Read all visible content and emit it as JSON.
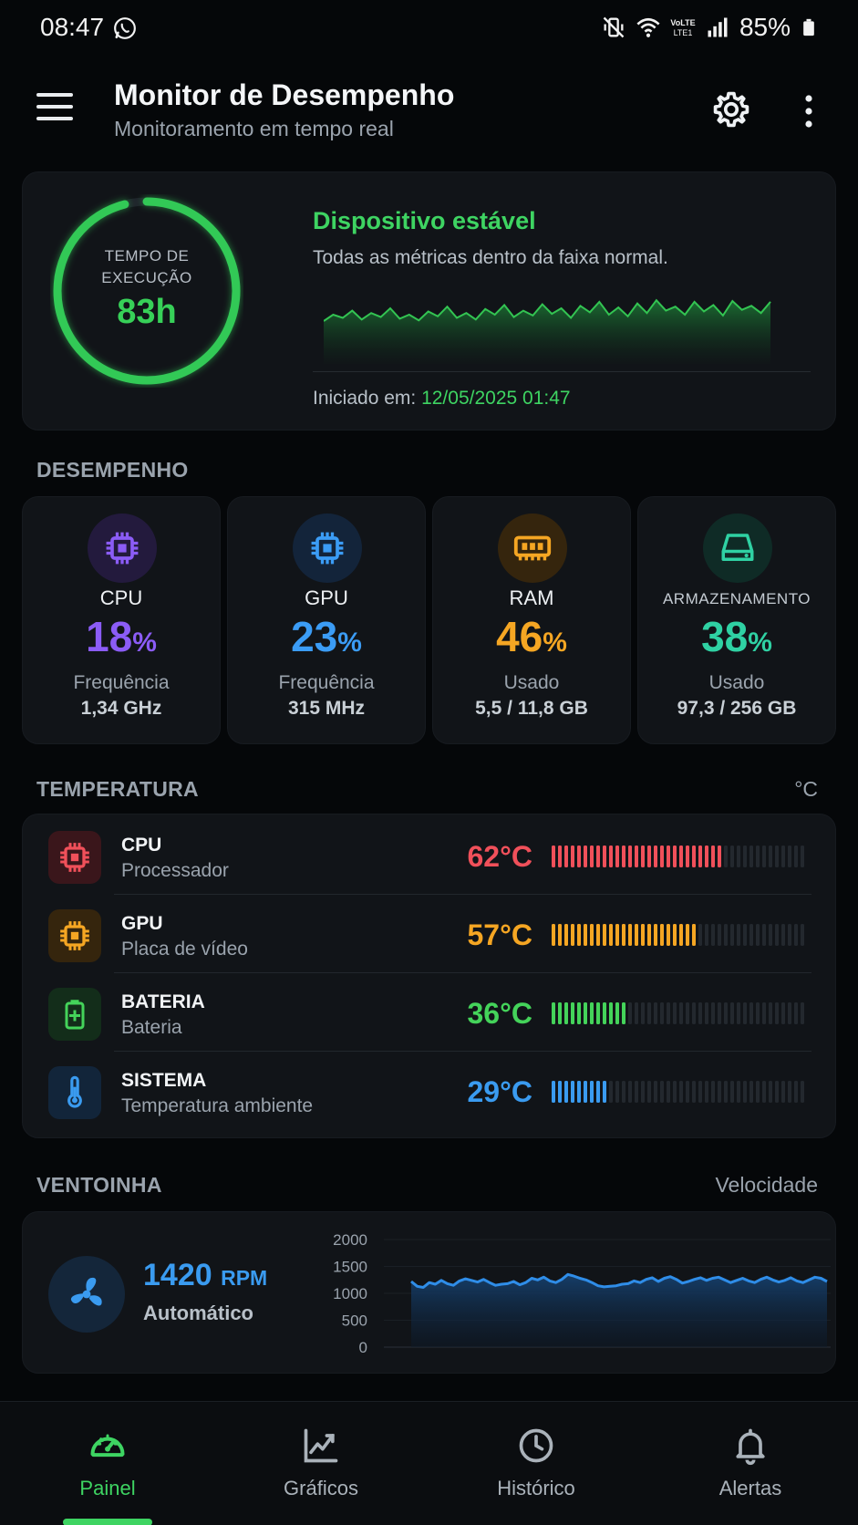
{
  "status_bar": {
    "time": "08:47",
    "battery": "85%",
    "icons": [
      "whatsapp-icon",
      "mute-vibrate-icon",
      "wifi-icon",
      "volte-icon",
      "signal-icon",
      "battery-icon"
    ]
  },
  "app_bar": {
    "title": "Monitor de Desempenho",
    "subtitle": "Monitoramento em tempo real",
    "icons": [
      "menu-icon",
      "gear-icon",
      "more-vert-icon"
    ]
  },
  "hero": {
    "ring_label_line1": "TEMPO DE",
    "ring_label_line2": "EXECUÇÃO",
    "ring_value": "83h",
    "ring_progress": 0.96,
    "status": "Dispositivo estável",
    "description": "Todas as métricas dentro da faixa normal.",
    "started_label": "Iniciado em:",
    "started_value": "12/05/2025 01:47",
    "sparkline": [
      0.42,
      0.5,
      0.46,
      0.55,
      0.44,
      0.52,
      0.47,
      0.58,
      0.45,
      0.5,
      0.43,
      0.54,
      0.48,
      0.6,
      0.46,
      0.52,
      0.44,
      0.57,
      0.5,
      0.62,
      0.47,
      0.55,
      0.49,
      0.63,
      0.51,
      0.58,
      0.46,
      0.61,
      0.53,
      0.66,
      0.5,
      0.59,
      0.48,
      0.64,
      0.52,
      0.68,
      0.55,
      0.6,
      0.5,
      0.66,
      0.54,
      0.62,
      0.49,
      0.67,
      0.56,
      0.61,
      0.52,
      0.66
    ]
  },
  "performance": {
    "title": "DESEMPENHO",
    "cards": [
      {
        "name": "CPU",
        "value": "18",
        "unit": "%",
        "label": "Frequência",
        "detail": "1,34 GHz",
        "color": "#8b5cf6",
        "icon": "cpu-icon"
      },
      {
        "name": "GPU",
        "value": "23",
        "unit": "%",
        "label": "Frequência",
        "detail": "315 MHz",
        "color": "#3b9cf5",
        "icon": "gpu-chip-icon"
      },
      {
        "name": "RAM",
        "value": "46",
        "unit": "%",
        "label": "Usado",
        "detail": "5,5 / 11,8 GB",
        "color": "#f5a623",
        "icon": "memory-icon"
      },
      {
        "name": "ARMAZENAMENTO",
        "value": "38",
        "unit": "%",
        "label": "Usado",
        "detail": "97,3 / 256 GB",
        "color": "#2fd1a3",
        "icon": "storage-icon"
      }
    ]
  },
  "temperature": {
    "title": "TEMPERATURA",
    "unit_label": "°C",
    "rows": [
      {
        "name": "CPU",
        "sub": "Processador",
        "value": "62°C",
        "level": 0.67,
        "color": "#f0505a",
        "icon": "cpu-icon"
      },
      {
        "name": "GPU",
        "sub": "Placa de vídeo",
        "value": "57°C",
        "level": 0.58,
        "color": "#f5a623",
        "icon": "gpu-chip-icon"
      },
      {
        "name": "BATERIA",
        "sub": "Bateria",
        "value": "36°C",
        "level": 0.31,
        "color": "#44d35a",
        "icon": "battery-charging-icon"
      },
      {
        "name": "SISTEMA",
        "sub": "Temperatura ambiente",
        "value": "29°C",
        "level": 0.22,
        "color": "#3a9bf0",
        "icon": "thermometer-icon"
      }
    ]
  },
  "fan": {
    "title": "VENTOINHA",
    "right_label": "Velocidade",
    "value": "1420",
    "unit": "RPM",
    "mode": "Automático",
    "y_ticks": [
      "2000",
      "1500",
      "1000",
      "500",
      "0"
    ],
    "ylim": [
      0,
      2000
    ],
    "chart_data": {
      "type": "area",
      "ylim": [
        0,
        2000
      ],
      "y_ticks": [
        2000,
        1500,
        1000,
        500,
        0
      ],
      "values": [
        1220,
        1130,
        1110,
        1200,
        1170,
        1240,
        1180,
        1150,
        1230,
        1270,
        1240,
        1210,
        1260,
        1200,
        1150,
        1170,
        1180,
        1220,
        1160,
        1200,
        1280,
        1250,
        1300,
        1230,
        1200,
        1260,
        1350,
        1320,
        1280,
        1250,
        1200,
        1140,
        1120,
        1130,
        1140,
        1170,
        1180,
        1230,
        1200,
        1260,
        1290,
        1220,
        1280,
        1310,
        1260,
        1190,
        1220,
        1260,
        1290,
        1240,
        1280,
        1300,
        1250,
        1200,
        1240,
        1280,
        1230,
        1200,
        1260,
        1300,
        1250,
        1210,
        1240,
        1290,
        1230,
        1200,
        1250,
        1300,
        1280,
        1220
      ]
    }
  },
  "bottom_nav": {
    "items": [
      {
        "label": "Painel",
        "icon": "speedometer-icon",
        "active": true
      },
      {
        "label": "Gráficos",
        "icon": "line-chart-icon",
        "active": false
      },
      {
        "label": "Histórico",
        "icon": "clock-icon",
        "active": false
      },
      {
        "label": "Alertas",
        "icon": "bell-icon",
        "active": false
      }
    ]
  },
  "colors": {
    "accent": "#3ed462",
    "background": "#050709",
    "card": "#111418"
  }
}
